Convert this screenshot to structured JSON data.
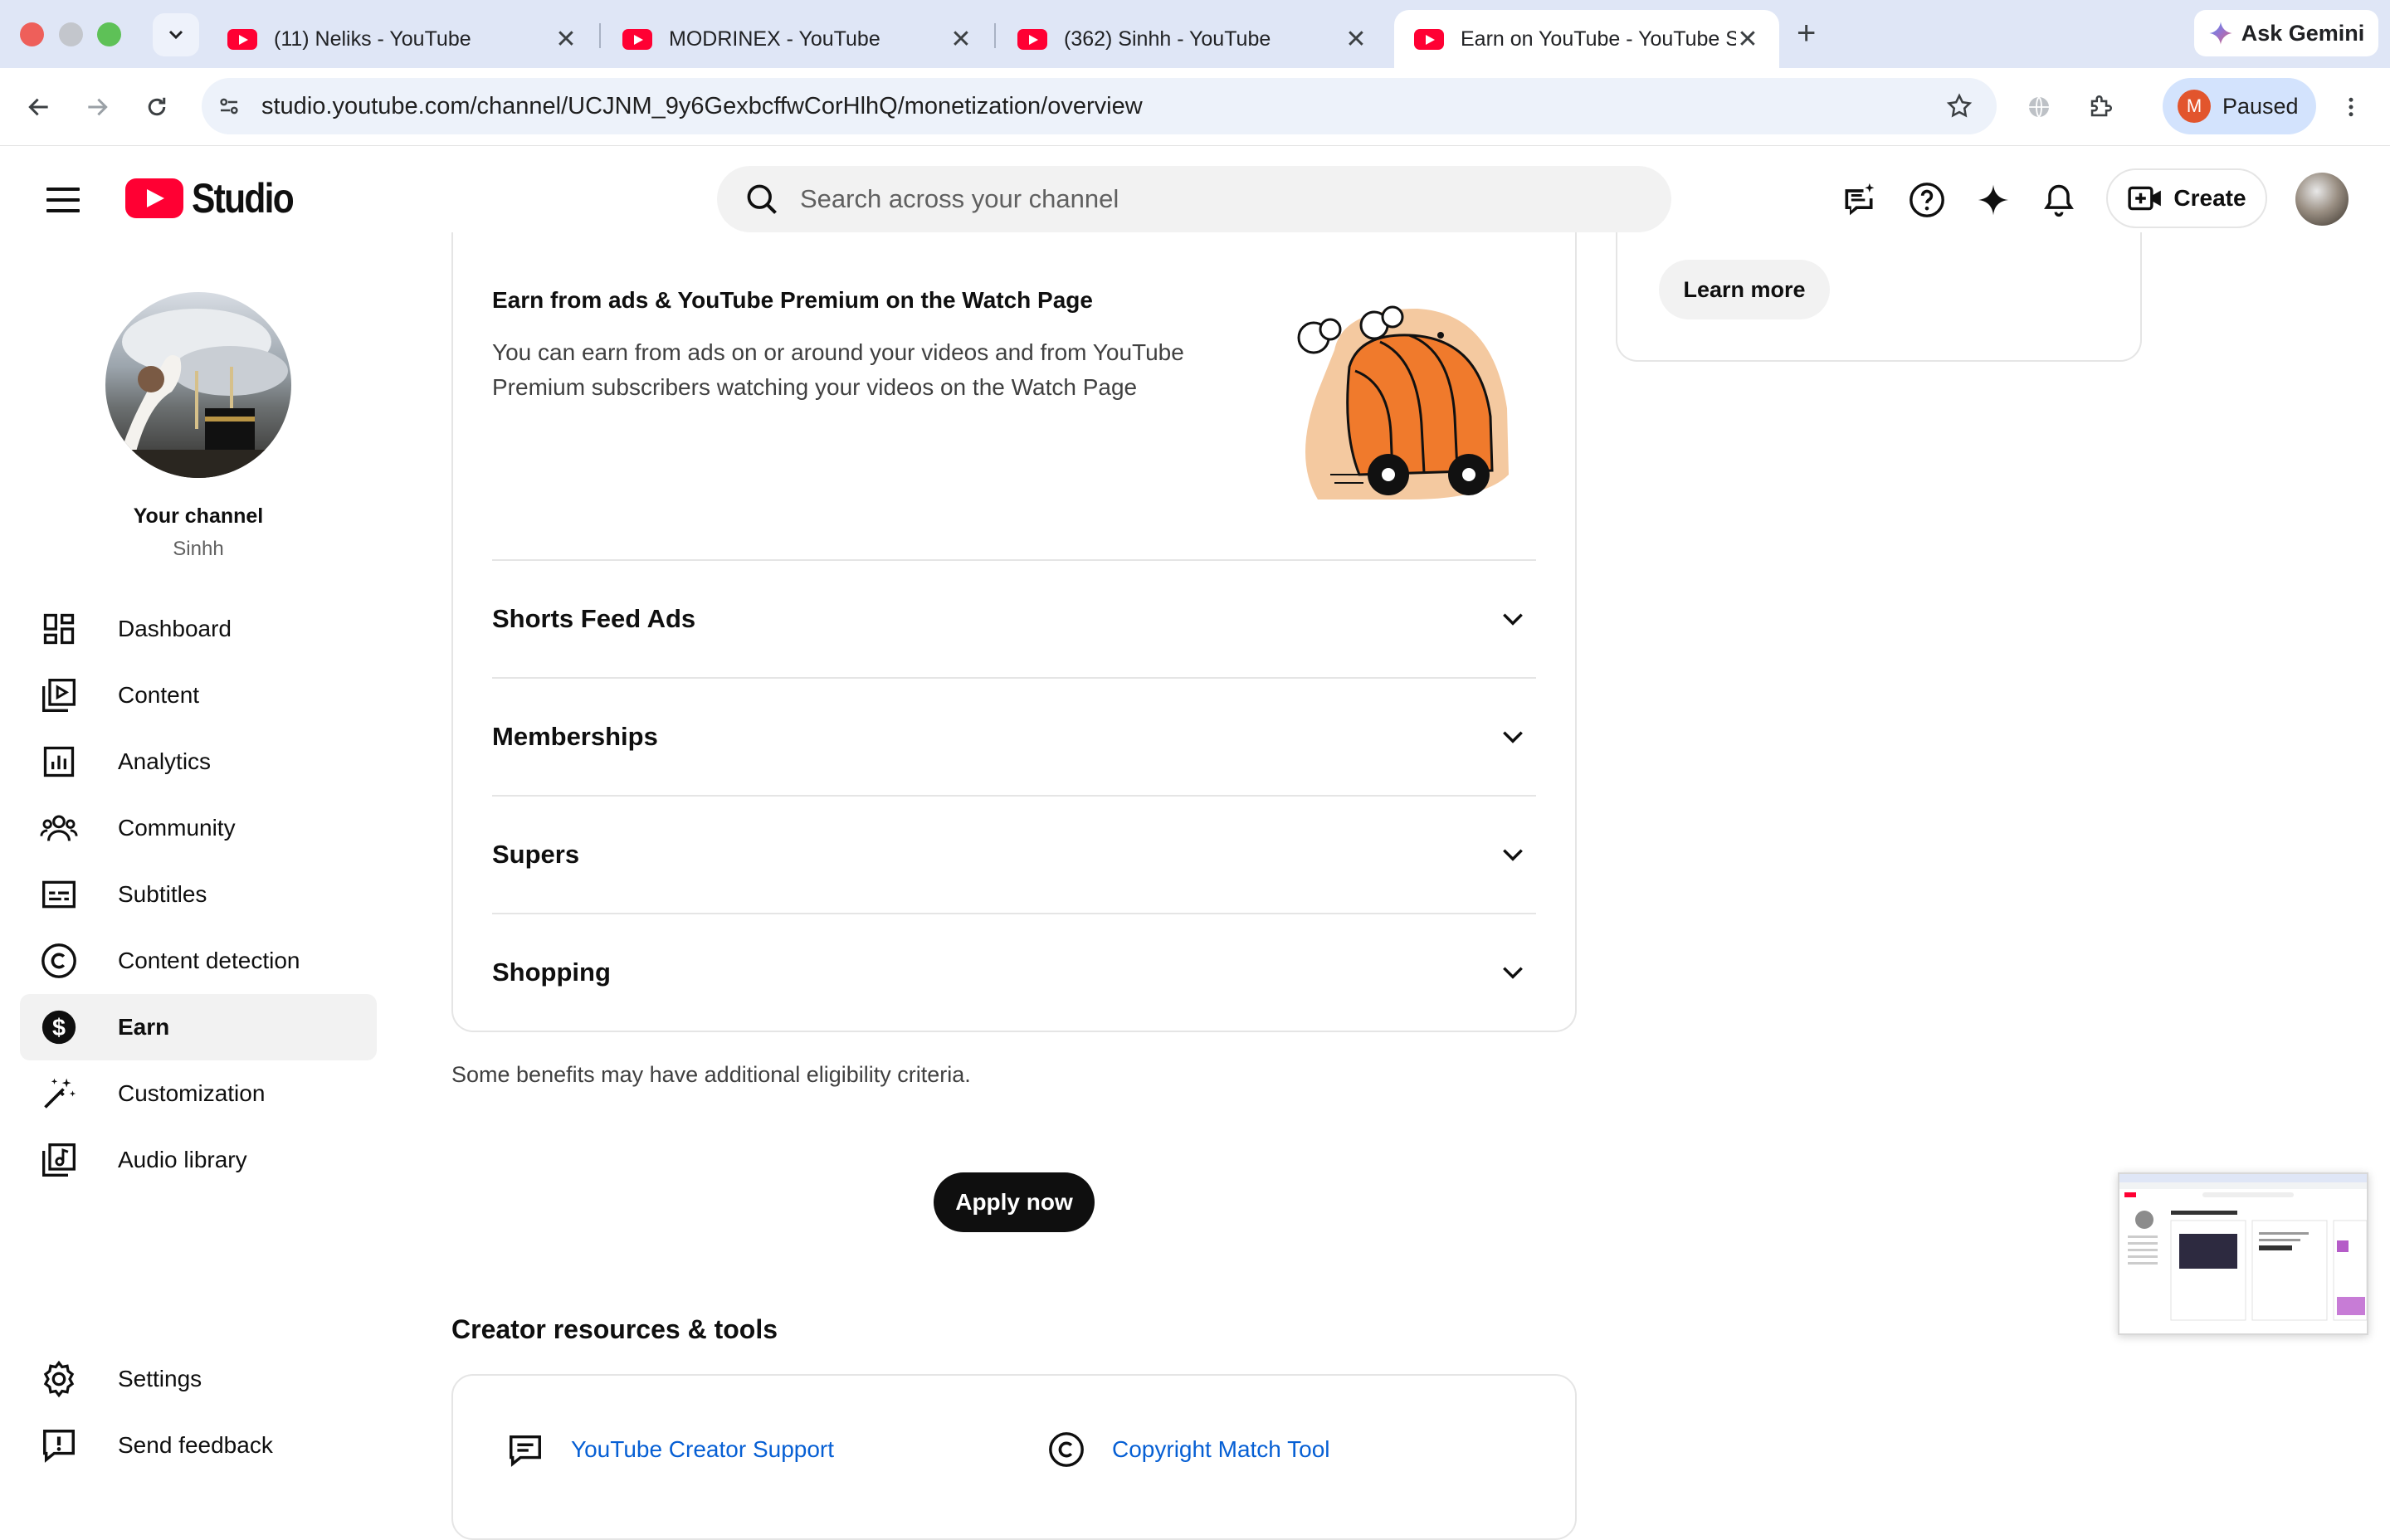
{
  "browser": {
    "tabs": [
      {
        "title": "(11) Neliks - YouTube",
        "active": false
      },
      {
        "title": "MODRINEX - YouTube",
        "active": false
      },
      {
        "title": "(362) Sinhh - YouTube",
        "active": false
      },
      {
        "title": "Earn on YouTube - YouTube Studio",
        "active": true
      }
    ],
    "close_glyph": "✕",
    "new_tab": "+",
    "gemini_label": "Ask Gemini",
    "url": "studio.youtube.com/channel/UCJNM_9y6GexbcffwCorHlhQ/monetization/overview",
    "profile_initial": "M",
    "profile_status": "Paused"
  },
  "header": {
    "logo_text": "Studio",
    "search_placeholder": "Search across your channel",
    "create_label": "Create"
  },
  "sidebar": {
    "channel_title": "Your channel",
    "channel_name": "Sinhh",
    "items": [
      {
        "label": "Dashboard",
        "icon": "dashboard-icon"
      },
      {
        "label": "Content",
        "icon": "content-icon"
      },
      {
        "label": "Analytics",
        "icon": "analytics-icon"
      },
      {
        "label": "Community",
        "icon": "community-icon"
      },
      {
        "label": "Subtitles",
        "icon": "subtitles-icon"
      },
      {
        "label": "Content detection",
        "icon": "copyright-icon"
      },
      {
        "label": "Earn",
        "icon": "dollar-icon",
        "active": true
      },
      {
        "label": "Customization",
        "icon": "magic-wand-icon"
      },
      {
        "label": "Audio library",
        "icon": "audio-library-icon"
      }
    ],
    "bottom_items": [
      {
        "label": "Settings",
        "icon": "gear-icon"
      },
      {
        "label": "Send feedback",
        "icon": "feedback-icon"
      }
    ]
  },
  "main": {
    "watch_title": "Earn from ads & YouTube Premium on the Watch Page",
    "watch_desc": "You can earn from ads on or around your videos and from YouTube Premium subscribers watching your videos on the Watch Page",
    "accordions": [
      "Shorts Feed Ads",
      "Memberships",
      "Supers",
      "Shopping"
    ],
    "note": "Some benefits may have additional eligibility criteria.",
    "apply_label": "Apply now",
    "resources_title": "Creator resources & tools",
    "resources": [
      {
        "label": "YouTube Creator Support",
        "icon": "chat-icon"
      },
      {
        "label": "Copyright Match Tool",
        "icon": "copyright-icon"
      }
    ]
  },
  "side": {
    "learn_more": "Learn more"
  },
  "colors": {
    "brand_red": "#ff0033",
    "link_blue": "#065fd4",
    "illustration_orange": "#f07a2c"
  }
}
